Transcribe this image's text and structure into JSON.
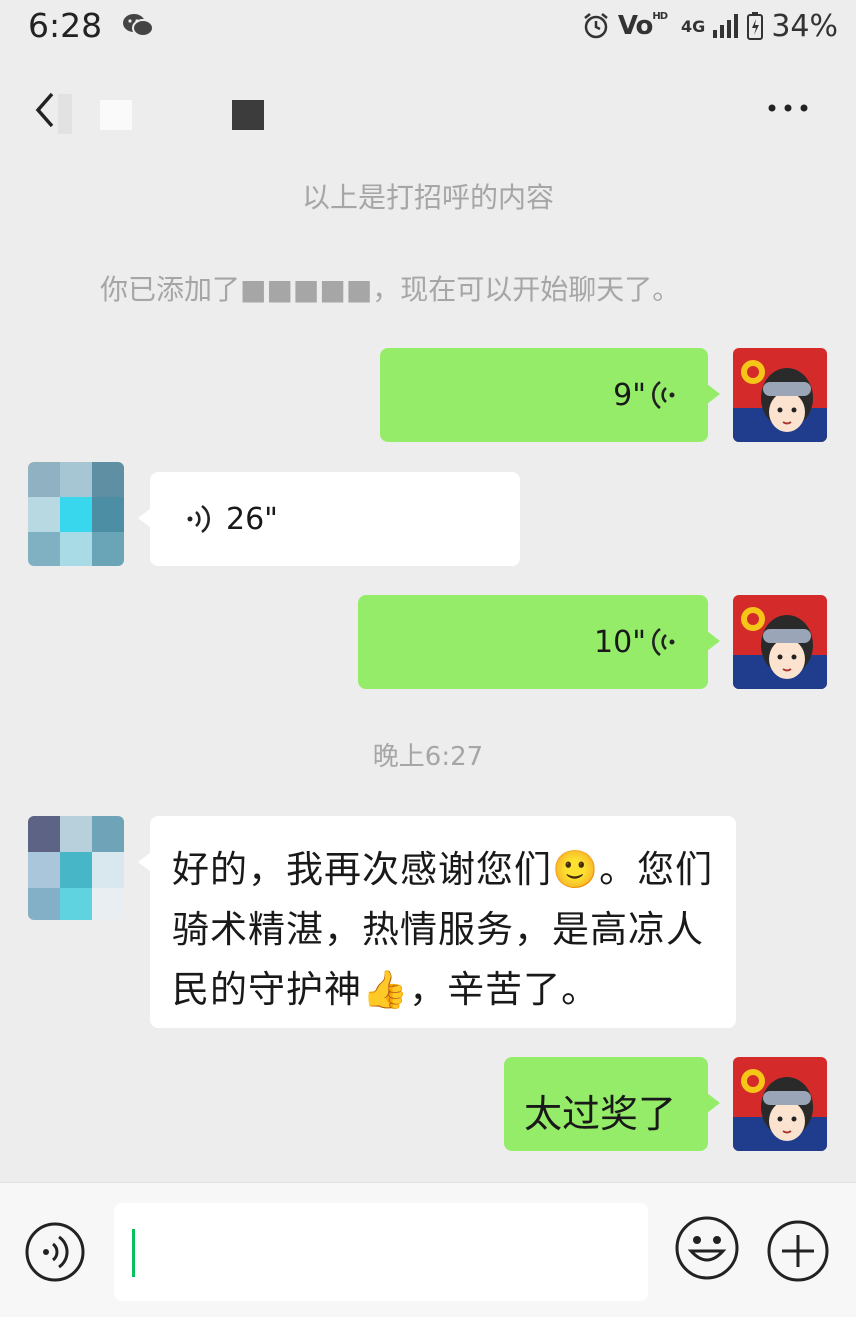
{
  "status_bar": {
    "time": "6:28",
    "volte": "Vo",
    "volte_sub": "HD",
    "network": "4G",
    "battery": "34%"
  },
  "nav": {
    "back_icon": "chevron-left-icon",
    "more_icon": "more-dots-icon"
  },
  "system": {
    "greeting_notice": "以上是打招呼的内容",
    "added_notice": "你已添加了■■■■■，现在可以开始聊天了。"
  },
  "messages": [
    {
      "side": "me",
      "type": "voice",
      "duration": "9\""
    },
    {
      "side": "them",
      "type": "voice",
      "duration": "26\""
    },
    {
      "side": "me",
      "type": "voice",
      "duration": "10\""
    },
    {
      "side": "them",
      "type": "text",
      "text": "好的，我再次感谢您们🙂。您们骑术精湛，热情服务，是高凉人民的守护神👍，辛苦了。"
    },
    {
      "side": "me",
      "type": "text",
      "text": "太过奖了"
    }
  ],
  "timestamp": "晚上6:27",
  "input_bar": {
    "voice_icon": "voice-input-icon",
    "emoji_icon": "emoji-icon",
    "plus_icon": "plus-icon"
  },
  "colors": {
    "background": "#ededed",
    "bubble_me": "#95ec69",
    "bubble_them": "#ffffff",
    "caret": "#07c160"
  }
}
